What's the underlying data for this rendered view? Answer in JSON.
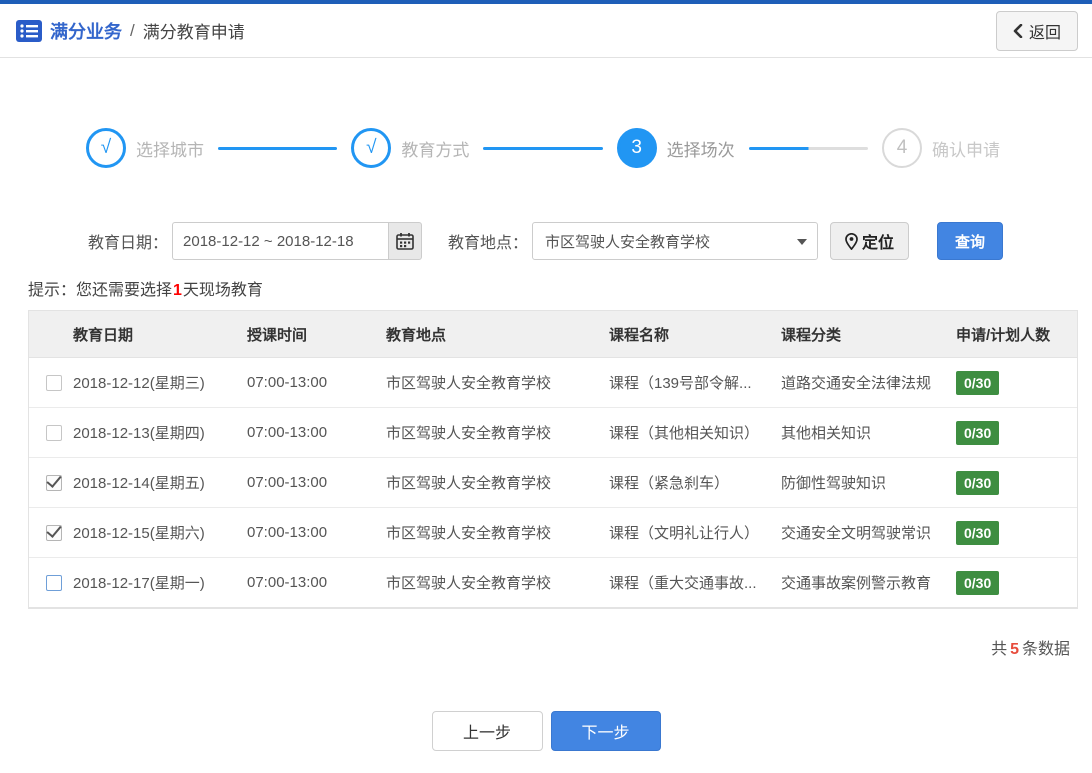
{
  "header": {
    "breadcrumb_section": "满分业务",
    "breadcrumb_separator": "/",
    "breadcrumb_page": "满分教育申请",
    "back_label": "返回"
  },
  "steps": [
    {
      "mark": "√",
      "label": "选择城市",
      "state": "done"
    },
    {
      "mark": "√",
      "label": "教育方式",
      "state": "done"
    },
    {
      "mark": "3",
      "label": "选择场次",
      "state": "active"
    },
    {
      "mark": "4",
      "label": "确认申请",
      "state": "pending"
    }
  ],
  "filters": {
    "date_label": "教育日期：",
    "date_value": "2018-12-12 ~ 2018-12-18",
    "location_label": "教育地点：",
    "location_value": "市区驾驶人安全教育学校",
    "locate_label": "定位",
    "search_label": "查询"
  },
  "hint": {
    "prefix": "提示：您还需要选择",
    "highlight": "1",
    "suffix": "天现场教育"
  },
  "table": {
    "columns": [
      "教育日期",
      "授课时间",
      "教育地点",
      "课程名称",
      "课程分类",
      "申请/计划人数"
    ],
    "rows": [
      {
        "checked": false,
        "focused": false,
        "date": "2018-12-12(星期三)",
        "time": "07:00-13:00",
        "place": "市区驾驶人安全教育学校",
        "course": "课程（139号部令解...",
        "category": "道路交通安全法律法规",
        "count": "0/30"
      },
      {
        "checked": false,
        "focused": false,
        "date": "2018-12-13(星期四)",
        "time": "07:00-13:00",
        "place": "市区驾驶人安全教育学校",
        "course": "课程（其他相关知识）",
        "category": "其他相关知识",
        "count": "0/30"
      },
      {
        "checked": true,
        "focused": false,
        "date": "2018-12-14(星期五)",
        "time": "07:00-13:00",
        "place": "市区驾驶人安全教育学校",
        "course": "课程（紧急刹车）",
        "category": "防御性驾驶知识",
        "count": "0/30"
      },
      {
        "checked": true,
        "focused": false,
        "date": "2018-12-15(星期六)",
        "time": "07:00-13:00",
        "place": "市区驾驶人安全教育学校",
        "course": "课程（文明礼让行人）",
        "category": "交通安全文明驾驶常识",
        "count": "0/30"
      },
      {
        "checked": false,
        "focused": true,
        "date": "2018-12-17(星期一)",
        "time": "07:00-13:00",
        "place": "市区驾驶人安全教育学校",
        "course": "课程（重大交通事故...",
        "category": "交通事故案例警示教育",
        "count": "0/30"
      }
    ]
  },
  "summary": {
    "prefix": "共",
    "count": "5",
    "suffix": "条数据"
  },
  "footer": {
    "prev_label": "上一步",
    "next_label": "下一步"
  },
  "icons": {
    "breadcrumb": "list-icon",
    "back": "chevron-left-icon",
    "date": "calendar-icon",
    "select": "caret-down-icon",
    "locate": "location-pin-icon"
  },
  "colors": {
    "topbar_blue": "#1e5eb8",
    "brand_blue": "#3366cc",
    "step_blue": "#2196f3",
    "button_blue": "#4285e2",
    "badge_green": "#3e8e41",
    "hint_red": "#ff0000",
    "count_red": "#e74c3c"
  }
}
